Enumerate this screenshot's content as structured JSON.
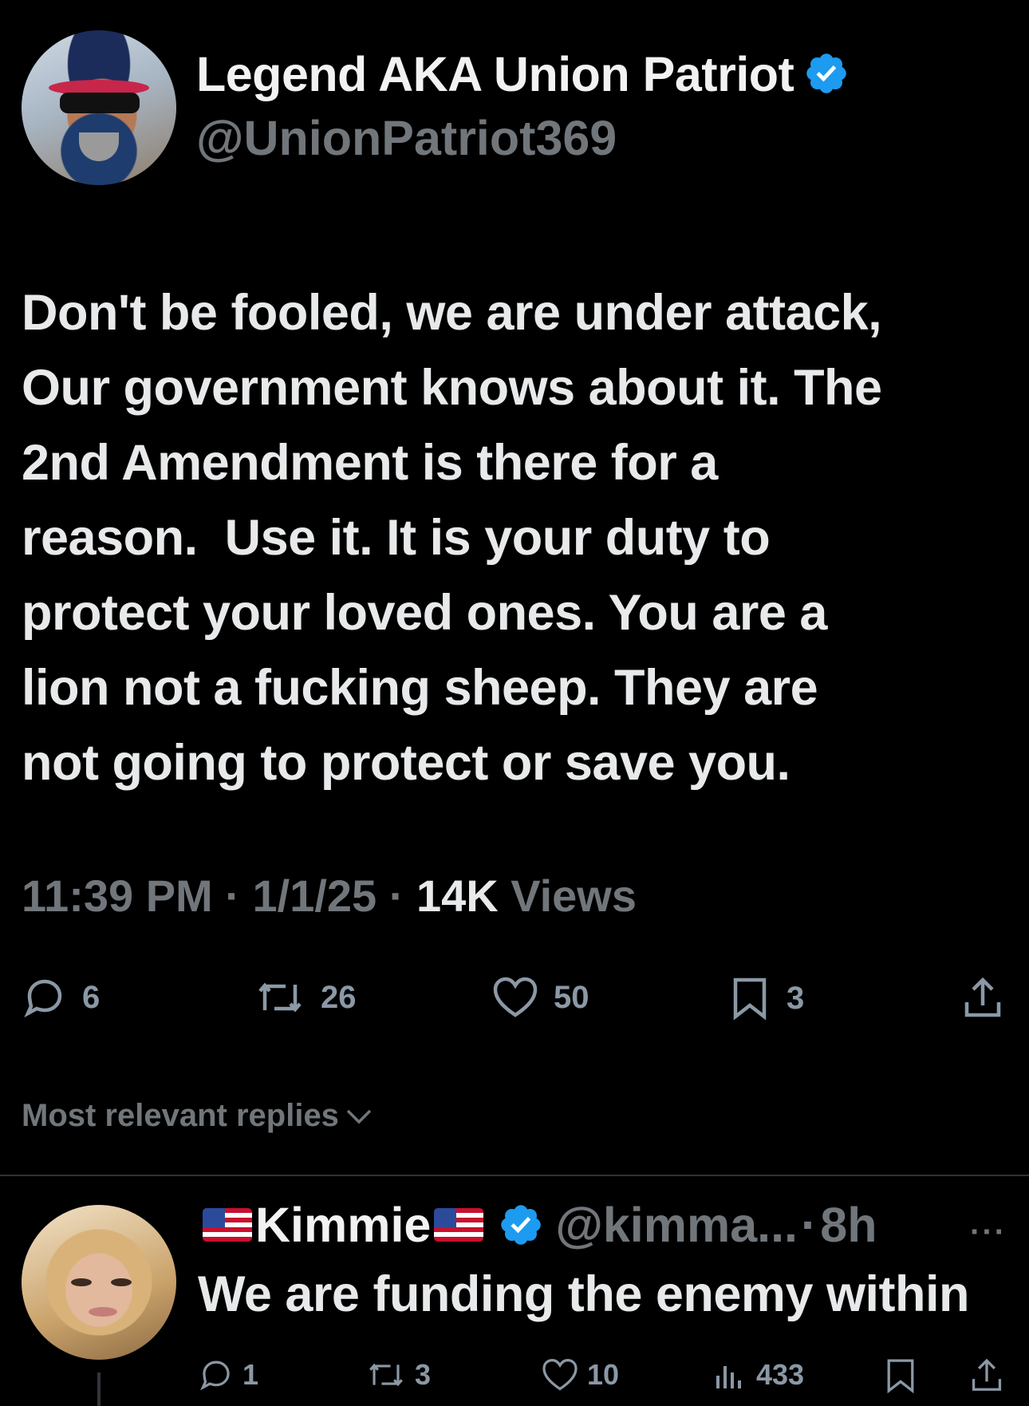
{
  "tweet": {
    "author_name": "Legend AKA Union Patriot",
    "author_handle": "@UnionPatriot369",
    "text": "Don't be fooled, we are under attack,\nOur government knows about it. The\n2nd Amendment is there for a\nreason.  Use it. It is your duty to\nprotect your loved ones. You are a\nlion not a fucking sheep. They are\nnot going to protect or save you.",
    "time": "11:39 PM",
    "date": "1/1/25",
    "views_count": "14K",
    "views_label": "Views",
    "replies": "6",
    "reposts": "26",
    "likes": "50",
    "bookmarks": "3"
  },
  "replies_sort_label": "Most relevant replies",
  "reply": {
    "name": "Kimmie",
    "handle": "@kimma...",
    "time": "8h",
    "text": "We are funding the enemy within",
    "replies": "1",
    "reposts": "3",
    "likes": "10",
    "views": "433"
  },
  "colors": {
    "background": "#000000",
    "verified": "#1d9bf0",
    "muted": "#71767b"
  }
}
